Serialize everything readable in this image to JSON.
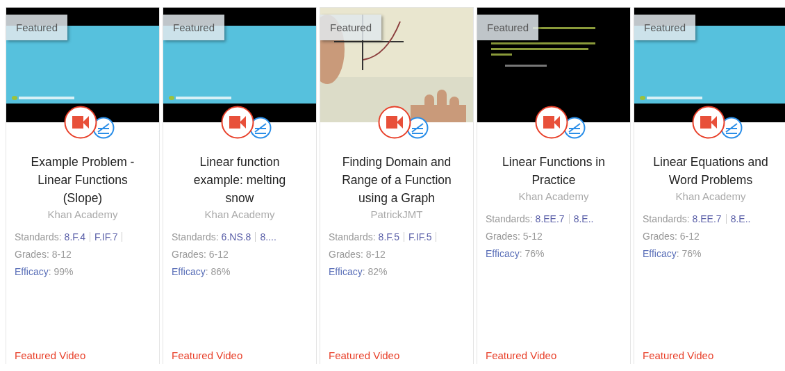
{
  "cards": [
    {
      "badge": "Featured",
      "title": "Example Problem - Linear Functions (Slope)",
      "source": "Khan Academy",
      "standards_label": "Standards:",
      "standards": [
        "8.F.4",
        "F.IF.7"
      ],
      "standards_truncated": true,
      "grades": "Grades: 8-12",
      "efficacy_label": "Efficacy",
      "efficacy": ": 99%",
      "footer": "Featured Video"
    },
    {
      "badge": "Featured",
      "title": "Linear function example: melting snow",
      "source": "Khan Academy",
      "standards_label": "Standards:",
      "standards": [
        "6.NS.8",
        "8...."
      ],
      "standards_truncated": false,
      "grades": "Grades: 6-12",
      "efficacy_label": "Efficacy",
      "efficacy": ": 86%",
      "footer": "Featured Video"
    },
    {
      "badge": "Featured",
      "title": "Finding Domain and Range of a Function using a Graph",
      "source": "PatrickJMT",
      "standards_label": "Standards:",
      "standards": [
        "8.F.5",
        "F.IF.5"
      ],
      "standards_truncated": true,
      "grades": "Grades: 8-12",
      "efficacy_label": "Efficacy",
      "efficacy": ": 82%",
      "footer": "Featured Video"
    },
    {
      "badge": "Featured",
      "title": "Linear Functions in Practice",
      "source": "Khan Academy",
      "standards_label": "Standards:",
      "standards": [
        "8.EE.7",
        "8.E.."
      ],
      "standards_truncated": false,
      "grades": "Grades: 5-12",
      "efficacy_label": "Efficacy",
      "efficacy": ": 76%",
      "footer": "Featured Video"
    },
    {
      "badge": "Featured",
      "title": "Linear Equations and Word Problems",
      "source": "Khan Academy",
      "standards_label": "Standards:",
      "standards": [
        "8.EE.7",
        "8.E.."
      ],
      "standards_truncated": false,
      "grades": "Grades: 6-12",
      "efficacy_label": "Efficacy",
      "efficacy": ": 76%",
      "footer": "Featured Video"
    }
  ]
}
